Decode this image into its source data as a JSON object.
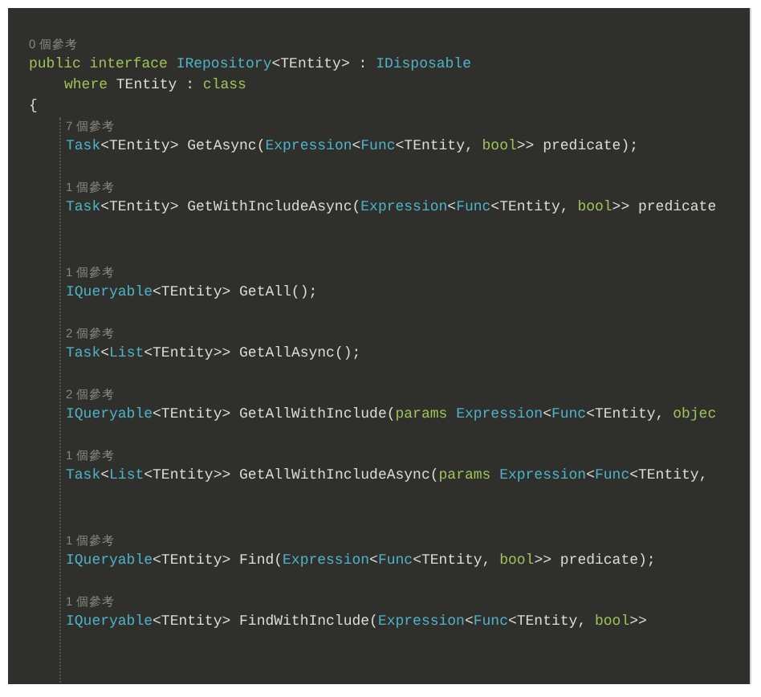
{
  "interface": {
    "references": "0 個參考",
    "declaration": [
      {
        "text": "public interface ",
        "kind": "keyword"
      },
      {
        "text": "IRepository",
        "kind": "type"
      },
      {
        "text": "<TEntity> : ",
        "kind": "plain"
      },
      {
        "text": "IDisposable",
        "kind": "type"
      }
    ],
    "constraint": [
      {
        "text": "where ",
        "kind": "keyword"
      },
      {
        "text": "TEntity : ",
        "kind": "plain"
      },
      {
        "text": "class",
        "kind": "keyword"
      }
    ],
    "open_brace": "{",
    "members": [
      {
        "kind": "member",
        "references": "7 個參考",
        "code": [
          {
            "text": "Task",
            "kind": "type"
          },
          {
            "text": "<TEntity> GetAsync(",
            "kind": "plain"
          },
          {
            "text": "Expression",
            "kind": "type"
          },
          {
            "text": "<",
            "kind": "plain"
          },
          {
            "text": "Func",
            "kind": "type"
          },
          {
            "text": "<TEntity, ",
            "kind": "plain"
          },
          {
            "text": "bool",
            "kind": "keyword"
          },
          {
            "text": ">> predicate);",
            "kind": "plain"
          }
        ]
      },
      {
        "kind": "member",
        "references": "1 個參考",
        "code": [
          {
            "text": "Task",
            "kind": "type"
          },
          {
            "text": "<TEntity> GetWithIncludeAsync(",
            "kind": "plain"
          },
          {
            "text": "Expression",
            "kind": "type"
          },
          {
            "text": "<",
            "kind": "plain"
          },
          {
            "text": "Func",
            "kind": "type"
          },
          {
            "text": "<TEntity, ",
            "kind": "plain"
          },
          {
            "text": "bool",
            "kind": "keyword"
          },
          {
            "text": ">> predicate",
            "kind": "plain"
          }
        ]
      },
      {
        "kind": "blank"
      },
      {
        "kind": "member",
        "references": "1 個參考",
        "code": [
          {
            "text": "IQueryable",
            "kind": "type"
          },
          {
            "text": "<TEntity> GetAll();",
            "kind": "plain"
          }
        ]
      },
      {
        "kind": "member",
        "references": "2 個參考",
        "code": [
          {
            "text": "Task",
            "kind": "type"
          },
          {
            "text": "<",
            "kind": "plain"
          },
          {
            "text": "List",
            "kind": "type"
          },
          {
            "text": "<TEntity>> GetAllAsync();",
            "kind": "plain"
          }
        ]
      },
      {
        "kind": "member",
        "references": "2 個參考",
        "code": [
          {
            "text": "IQueryable",
            "kind": "type"
          },
          {
            "text": "<TEntity> GetAllWithInclude(",
            "kind": "plain"
          },
          {
            "text": "params ",
            "kind": "keyword"
          },
          {
            "text": "Expression",
            "kind": "type"
          },
          {
            "text": "<",
            "kind": "plain"
          },
          {
            "text": "Func",
            "kind": "type"
          },
          {
            "text": "<TEntity, ",
            "kind": "plain"
          },
          {
            "text": "objec",
            "kind": "keyword"
          }
        ]
      },
      {
        "kind": "member",
        "references": "1 個參考",
        "code": [
          {
            "text": "Task",
            "kind": "type"
          },
          {
            "text": "<",
            "kind": "plain"
          },
          {
            "text": "List",
            "kind": "type"
          },
          {
            "text": "<TEntity>> GetAllWithIncludeAsync(",
            "kind": "plain"
          },
          {
            "text": "params ",
            "kind": "keyword"
          },
          {
            "text": "Expression",
            "kind": "type"
          },
          {
            "text": "<",
            "kind": "plain"
          },
          {
            "text": "Func",
            "kind": "type"
          },
          {
            "text": "<TEntity, ",
            "kind": "plain"
          }
        ]
      },
      {
        "kind": "blank"
      },
      {
        "kind": "member",
        "references": "1 個參考",
        "code": [
          {
            "text": "IQueryable",
            "kind": "type"
          },
          {
            "text": "<TEntity> Find(",
            "kind": "plain"
          },
          {
            "text": "Expression",
            "kind": "type"
          },
          {
            "text": "<",
            "kind": "plain"
          },
          {
            "text": "Func",
            "kind": "type"
          },
          {
            "text": "<TEntity, ",
            "kind": "plain"
          },
          {
            "text": "bool",
            "kind": "keyword"
          },
          {
            "text": ">> predicate);",
            "kind": "plain"
          }
        ]
      },
      {
        "kind": "member",
        "references": "1 個參考",
        "code": [
          {
            "text": "IQueryable",
            "kind": "type"
          },
          {
            "text": "<TEntity> FindWithInclude(",
            "kind": "plain"
          },
          {
            "text": "Expression",
            "kind": "type"
          },
          {
            "text": "<",
            "kind": "plain"
          },
          {
            "text": "Func",
            "kind": "type"
          },
          {
            "text": "<TEntity, ",
            "kind": "plain"
          },
          {
            "text": "bool",
            "kind": "keyword"
          },
          {
            "text": ">>",
            "kind": "plain"
          }
        ]
      }
    ]
  }
}
